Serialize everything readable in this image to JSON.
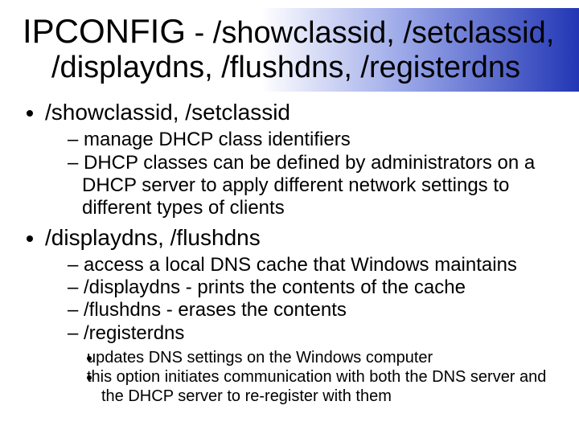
{
  "title": {
    "bigword": "IPCONFIG",
    "sep": " - ",
    "rest1": "/showclassid, /setclassid,",
    "line2": "/displaydns, /flushdns, /registerdns"
  },
  "b1": {
    "heading": "/showclassid, /setclassid",
    "items": [
      "manage DHCP class identifiers",
      "DHCP classes can be defined by administrators on a DHCP server to apply different network settings to different types of clients"
    ]
  },
  "b2": {
    "heading": "/displaydns, /flushdns",
    "items": [
      "access a local DNS cache that Windows maintains",
      "/displaydns  - prints the contents of the cache",
      "/flushdns - erases the contents",
      "/registerdns"
    ],
    "sub": [
      "updates DNS settings on the Windows computer",
      "this option initiates communication with both the DNS server and the DHCP server to re-register with them"
    ]
  }
}
